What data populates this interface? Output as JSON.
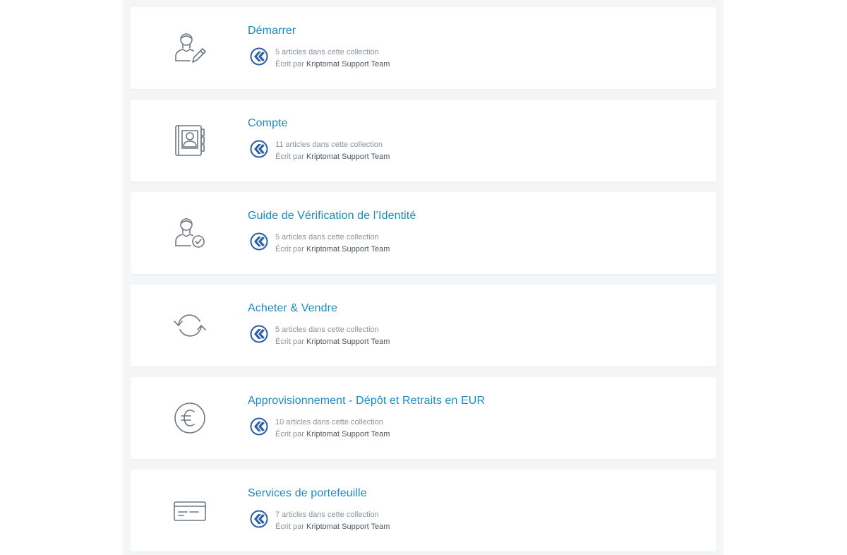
{
  "colors": {
    "accent": "#1a8ac0",
    "icon_stroke": "#6f7780",
    "avatar_blue": "#2a5fa8",
    "background": "#f3f5f7",
    "card": "#ffffff"
  },
  "collections": [
    {
      "title": "Démarrer",
      "icon": "user-edit-icon",
      "article_count": "5 articles dans cette collection",
      "written_by_prefix": "Écrit par",
      "author": "Kriptomat Support Team"
    },
    {
      "title": "Compte",
      "icon": "address-book-icon",
      "article_count": "11 articles dans cette collection",
      "written_by_prefix": "Écrit par",
      "author": "Kriptomat Support Team"
    },
    {
      "title": "Guide de Vérification de l’Identité",
      "icon": "user-check-icon",
      "article_count": "5 articles dans cette collection",
      "written_by_prefix": "Écrit par",
      "author": "Kriptomat Support Team"
    },
    {
      "title": "Acheter & Vendre",
      "icon": "exchange-arrows-icon",
      "article_count": "5 articles dans cette collection",
      "written_by_prefix": "Écrit par",
      "author": "Kriptomat Support Team"
    },
    {
      "title": "Approvisionnement - Dépôt et Retraits en EUR",
      "icon": "euro-circle-icon",
      "article_count": "10 articles dans cette collection",
      "written_by_prefix": "Écrit par",
      "author": "Kriptomat Support Team"
    },
    {
      "title": "Services de portefeuille",
      "icon": "credit-card-icon",
      "article_count": "7 articles dans cette collection",
      "written_by_prefix": "Écrit par",
      "author": "Kriptomat Support Team"
    }
  ]
}
